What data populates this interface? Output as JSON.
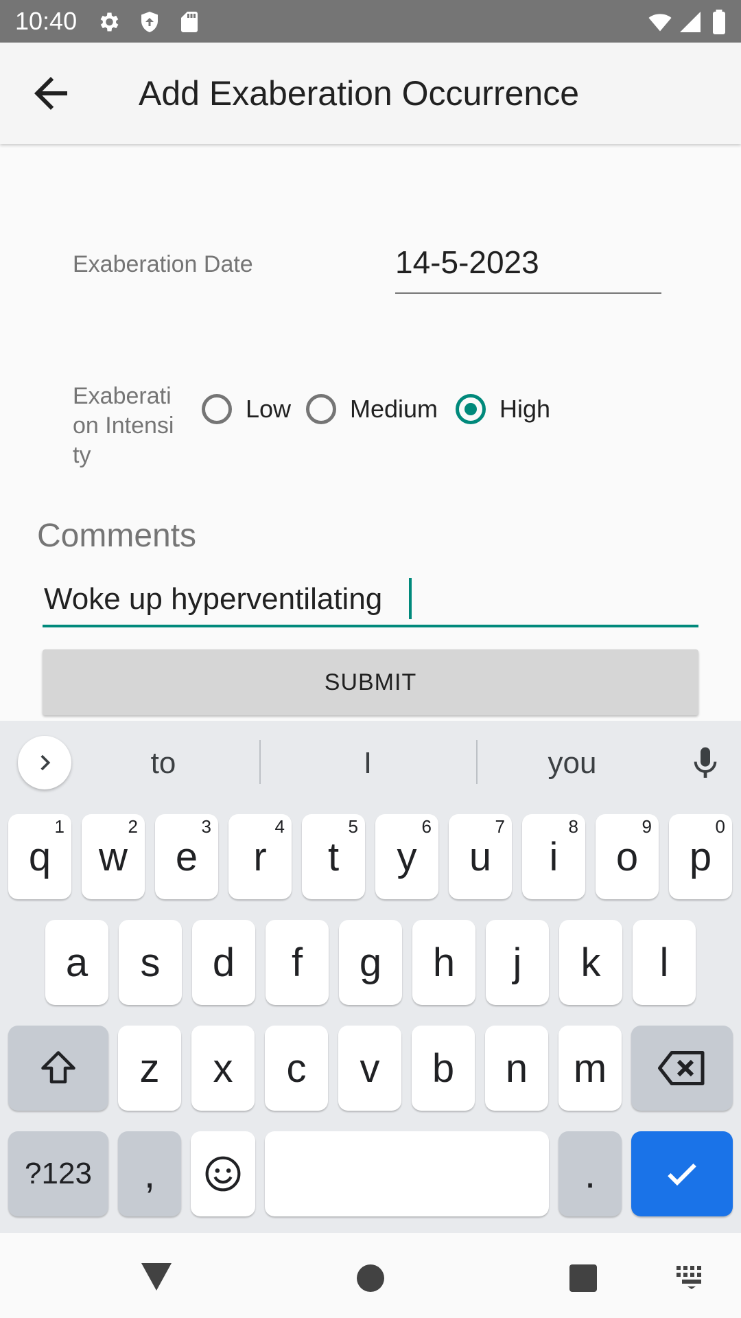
{
  "status_bar": {
    "time": "10:40",
    "icons": [
      "settings-icon",
      "shield-icon",
      "sd-card-icon",
      "wifi-icon",
      "signal-icon",
      "battery-icon"
    ]
  },
  "app_bar": {
    "title": "Add Exaberation Occurrence",
    "back_icon": "arrow-back-icon"
  },
  "form": {
    "date_label": "Exaberation Date",
    "date_value": "14-5-2023",
    "intensity_label": "Exaberation Intensity",
    "intensity_options": [
      {
        "label": "Low",
        "checked": false
      },
      {
        "label": "Medium",
        "checked": false
      },
      {
        "label": "High",
        "checked": true
      }
    ],
    "comments_label": "Comments",
    "comments_value": "Woke up hyperventilating",
    "submit_label": "SUBMIT"
  },
  "keyboard": {
    "suggestions": [
      "to",
      "I",
      "you"
    ],
    "row1": [
      {
        "key": "q",
        "num": "1"
      },
      {
        "key": "w",
        "num": "2"
      },
      {
        "key": "e",
        "num": "3"
      },
      {
        "key": "r",
        "num": "4"
      },
      {
        "key": "t",
        "num": "5"
      },
      {
        "key": "y",
        "num": "6"
      },
      {
        "key": "u",
        "num": "7"
      },
      {
        "key": "i",
        "num": "8"
      },
      {
        "key": "o",
        "num": "9"
      },
      {
        "key": "p",
        "num": "0"
      }
    ],
    "row2": [
      "a",
      "s",
      "d",
      "f",
      "g",
      "h",
      "j",
      "k",
      "l"
    ],
    "row3": [
      "z",
      "x",
      "c",
      "v",
      "b",
      "n",
      "m"
    ],
    "symbols_label": "?123",
    "comma_label": ",",
    "period_label": ".",
    "accent_color": "#1a73e8"
  },
  "colors": {
    "accent": "#00897b",
    "status_bar": "#757575"
  }
}
